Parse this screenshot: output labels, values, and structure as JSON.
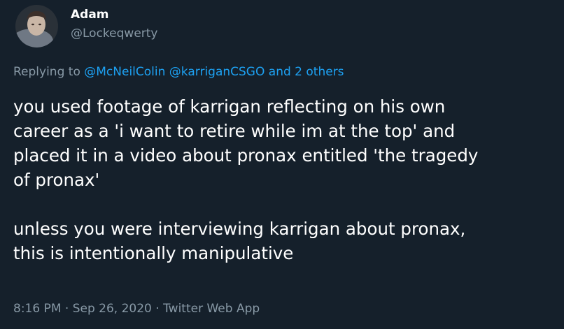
{
  "author": {
    "display_name": "Adam",
    "handle": "@Lockeqwerty",
    "avatar_icon": "profile-photo"
  },
  "reply_context": {
    "prefix": "Replying to",
    "mention_1": "@McNeilColin",
    "mention_2": "@karriganCSGO",
    "conjunction": "and",
    "others": "2 others"
  },
  "tweet": {
    "text": "you used footage of karrigan reflecting on his own\ncareer as a 'i want to retire while im at the top' and\nplaced it in a video about pronax entitled 'the tragedy\nof pronax'\n\nunless you were interviewing karrigan about pronax,\nthis is intentionally manipulative",
    "time": "8:16 PM",
    "separator": "·",
    "date": "Sep 26, 2020",
    "source": "Twitter Web App"
  },
  "colors": {
    "background": "#15202b",
    "text": "#ffffff",
    "secondary": "#8899a6",
    "link": "#1da1f2"
  }
}
